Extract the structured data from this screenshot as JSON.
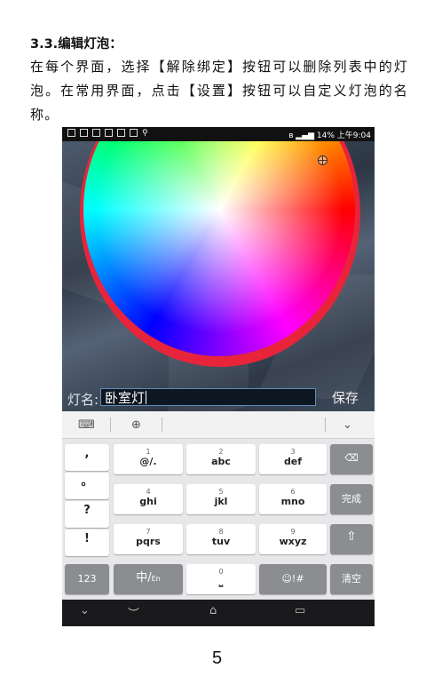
{
  "doc": {
    "heading": "3.3.编辑灯泡：",
    "paragraph": "在每个界面，选择【解除绑定】按钮可以删除列表中的灯泡。在常用界面，点击【设置】按钮可以自定义灯泡的名称。",
    "page_number": "5"
  },
  "phone": {
    "status": {
      "right": "14% 上午9:04"
    },
    "form": {
      "name_label": "灯名:",
      "name_value": "卧室灯",
      "save_label": "保存"
    },
    "keyboard": {
      "punct": [
        ",",
        "。",
        "?",
        "!"
      ],
      "rows": [
        [
          {
            "num": "1",
            "lbl": "@/."
          },
          {
            "num": "2",
            "lbl": "abc"
          },
          {
            "num": "3",
            "lbl": "def"
          }
        ],
        [
          {
            "num": "4",
            "lbl": "ghi"
          },
          {
            "num": "5",
            "lbl": "jkl"
          },
          {
            "num": "6",
            "lbl": "mno"
          }
        ],
        [
          {
            "num": "7",
            "lbl": "pqrs"
          },
          {
            "num": "8",
            "lbl": "tuv"
          },
          {
            "num": "9",
            "lbl": "wxyz"
          }
        ]
      ],
      "done_label": "完成",
      "symbols_123": "123",
      "lang_label": "中/",
      "lang_sub": "En",
      "space_num": "0",
      "emoji_label": "☺!#",
      "clear_label": "清空"
    },
    "icons": [
      "keyboard-icon",
      "globe-icon",
      "chevron-down-icon",
      "backspace-icon",
      "shift-icon",
      "back-nav-icon",
      "home-nav-icon",
      "recents-nav-icon"
    ]
  }
}
